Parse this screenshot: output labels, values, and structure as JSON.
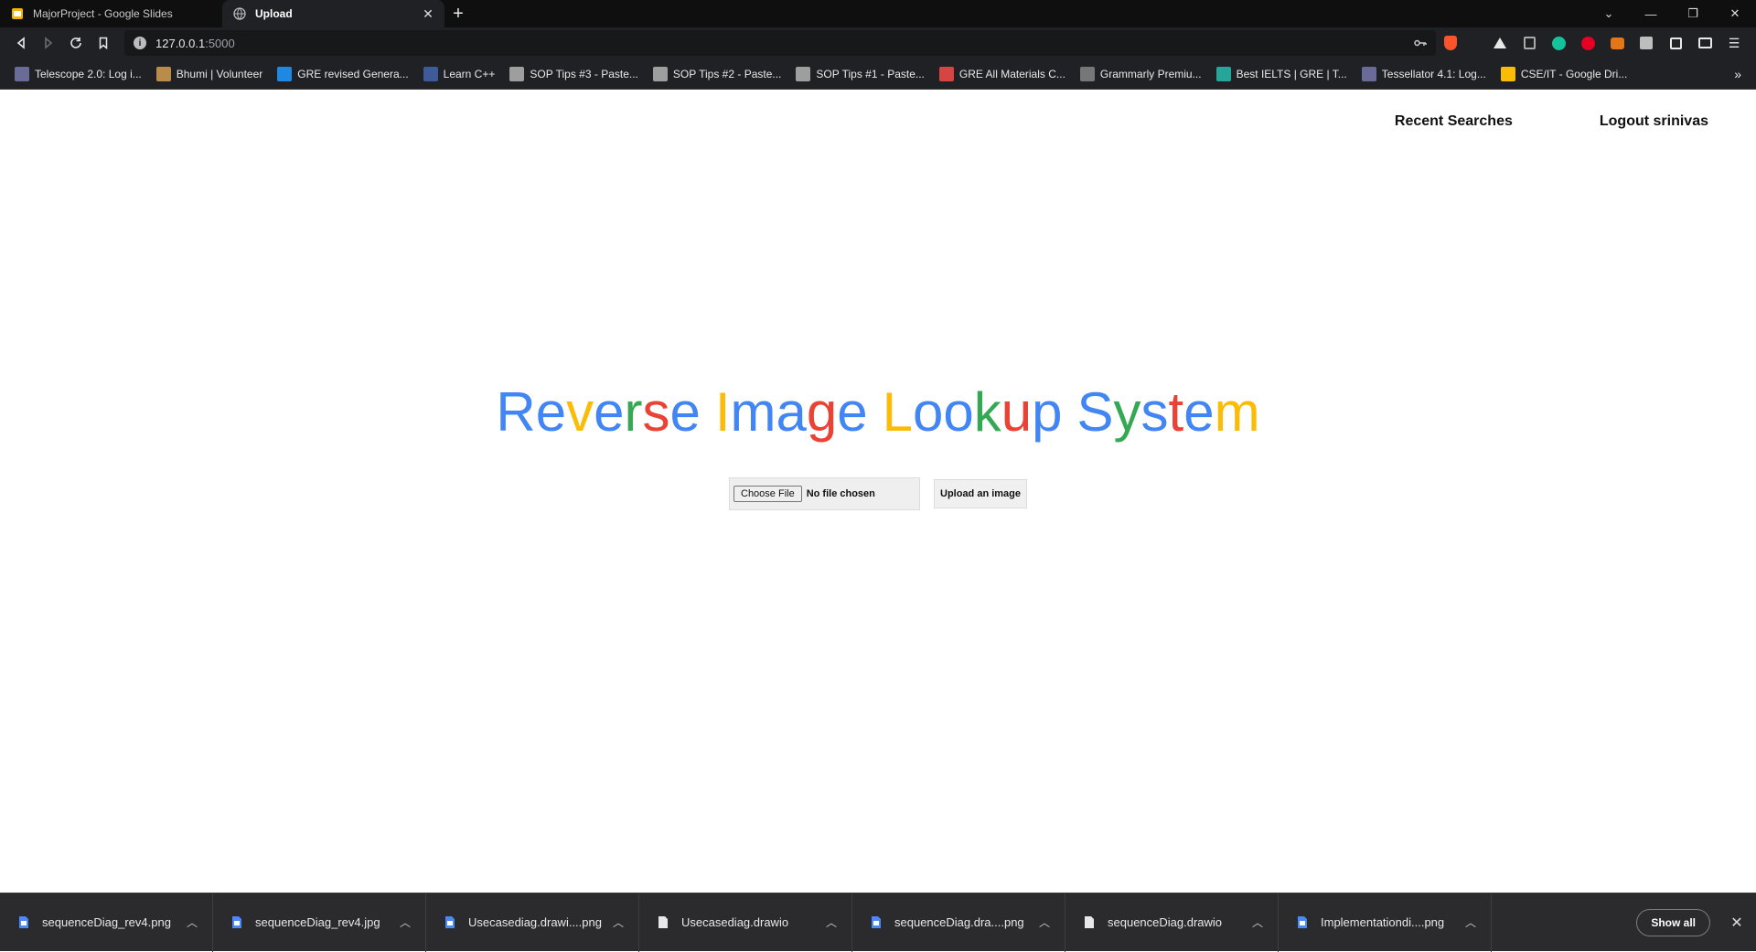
{
  "tabs": [
    {
      "title": "MajorProject - Google Slides",
      "active": false,
      "favicon": "google-slides-icon"
    },
    {
      "title": "Upload",
      "active": true,
      "favicon": "globe-icon"
    }
  ],
  "window_controls": [
    "tab-search-icon",
    "minimize-icon",
    "restore-icon",
    "close-icon"
  ],
  "address_bar": {
    "host": "127.0.0.1",
    "port": ":5000"
  },
  "extensions": [
    "brave-shield-icon",
    "rewards-icon",
    "vercel-icon",
    "reader-icon",
    "grammarly-icon",
    "pinterest-icon",
    "metamask-icon",
    "extension-icon",
    "puzzle-icon",
    "wallet-icon",
    "menu-icon"
  ],
  "bookmarks": [
    {
      "label": "Telescope 2.0: Log i...",
      "color": "#6b6b9a"
    },
    {
      "label": "Bhumi | Volunteer",
      "color": "#b98c4a"
    },
    {
      "label": "GRE revised Genera...",
      "color": "#1e88e5"
    },
    {
      "label": "Learn C++",
      "color": "#3d5a99"
    },
    {
      "label": "SOP Tips #3 - Paste...",
      "color": "#9e9e9e"
    },
    {
      "label": "SOP Tips #2 - Paste...",
      "color": "#9e9e9e"
    },
    {
      "label": "SOP Tips #1 - Paste...",
      "color": "#9e9e9e"
    },
    {
      "label": "GRE All Materials C...",
      "color": "#d64541"
    },
    {
      "label": "Grammarly Premiu...",
      "color": "#777777"
    },
    {
      "label": "Best IELTS | GRE | T...",
      "color": "#26a69a"
    },
    {
      "label": "Tessellator 4.1: Log...",
      "color": "#6b6b9a"
    },
    {
      "label": "CSE/IT - Google Dri...",
      "color": "#fbbc04"
    }
  ],
  "page": {
    "nav": {
      "recent": "Recent Searches",
      "logout": "Logout srinivas"
    },
    "title_letters": [
      {
        "ch": "R",
        "color": "#4285f4"
      },
      {
        "ch": "e",
        "color": "#4285f4"
      },
      {
        "ch": "v",
        "color": "#fbbc05"
      },
      {
        "ch": "e",
        "color": "#4285f4"
      },
      {
        "ch": "r",
        "color": "#34a853"
      },
      {
        "ch": "s",
        "color": "#ea4335"
      },
      {
        "ch": "e",
        "color": "#4285f4"
      },
      {
        "ch": " ",
        "color": "#000000"
      },
      {
        "ch": "I",
        "color": "#fbbc05"
      },
      {
        "ch": "m",
        "color": "#4285f4"
      },
      {
        "ch": "a",
        "color": "#4285f4"
      },
      {
        "ch": "g",
        "color": "#ea4335"
      },
      {
        "ch": "e",
        "color": "#4285f4"
      },
      {
        "ch": " ",
        "color": "#000000"
      },
      {
        "ch": "L",
        "color": "#fbbc05"
      },
      {
        "ch": "o",
        "color": "#4285f4"
      },
      {
        "ch": "o",
        "color": "#4285f4"
      },
      {
        "ch": "k",
        "color": "#34a853"
      },
      {
        "ch": "u",
        "color": "#ea4335"
      },
      {
        "ch": "p",
        "color": "#4285f4"
      },
      {
        "ch": " ",
        "color": "#000000"
      },
      {
        "ch": "S",
        "color": "#4285f4"
      },
      {
        "ch": "y",
        "color": "#34a853"
      },
      {
        "ch": "s",
        "color": "#4285f4"
      },
      {
        "ch": "t",
        "color": "#ea4335"
      },
      {
        "ch": "e",
        "color": "#4285f4"
      },
      {
        "ch": "m",
        "color": "#fbbc05"
      }
    ],
    "file_input": {
      "button": "Choose File",
      "status": "No file chosen"
    },
    "upload_button": "Upload an image"
  },
  "downloads": [
    {
      "name": "sequenceDiag_rev4.png",
      "icon": "image-file-icon"
    },
    {
      "name": "sequenceDiag_rev4.jpg",
      "icon": "image-file-icon"
    },
    {
      "name": "Usecasediag.drawi....png",
      "icon": "image-file-icon"
    },
    {
      "name": "Usecasediag.drawio",
      "icon": "file-icon"
    },
    {
      "name": "sequenceDiag.dra....png",
      "icon": "image-file-icon"
    },
    {
      "name": "sequenceDiag.drawio",
      "icon": "file-icon"
    },
    {
      "name": "Implementationdi....png",
      "icon": "image-file-icon"
    }
  ],
  "shelf": {
    "show_all": "Show all"
  }
}
